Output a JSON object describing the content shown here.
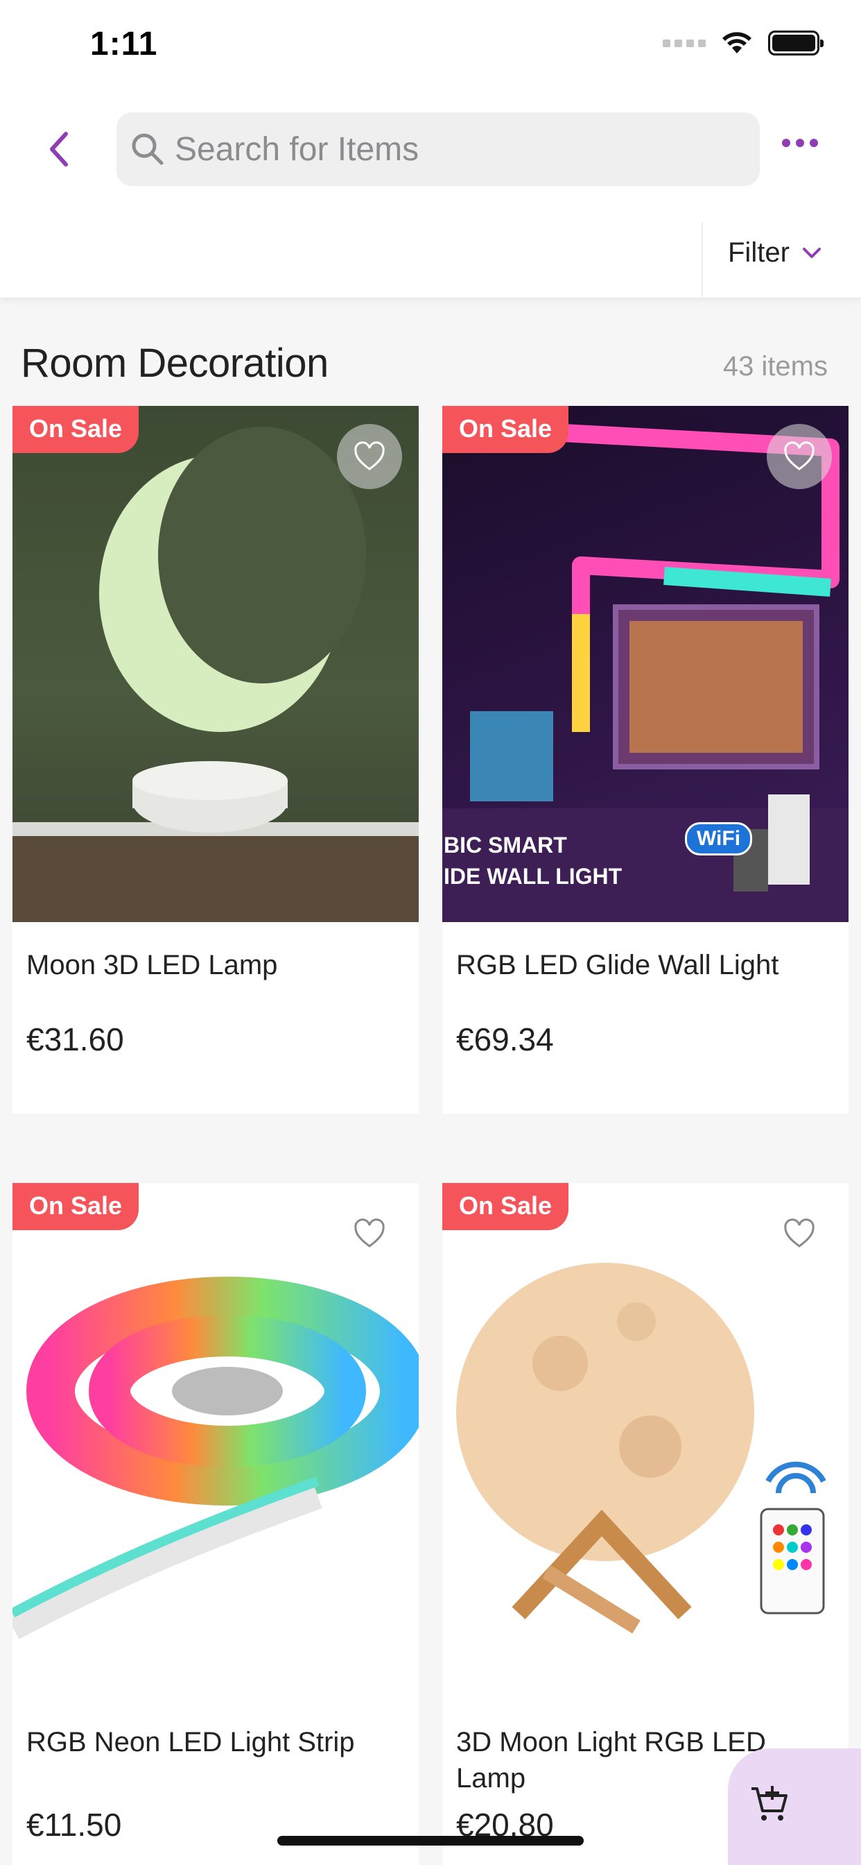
{
  "status_bar": {
    "time": "1:11"
  },
  "header": {
    "search_placeholder": "Search for Items",
    "back_icon": "chevron-left-icon",
    "more_icon": "more-horizontal-icon",
    "accent_color": "#8e3db5"
  },
  "filter": {
    "label": "Filter"
  },
  "section": {
    "title": "Room Decoration",
    "count": "43 items"
  },
  "products": [
    {
      "name": "Moon 3D LED Lamp",
      "price": "€31.60",
      "badge": "On Sale"
    },
    {
      "name": "RGB LED Glide Wall Light",
      "price": "€69.34",
      "badge": "On Sale",
      "image_text_1": "BIC SMART",
      "image_text_2": "IDE WALL LIGHT",
      "image_badge": "WiFi"
    },
    {
      "name": "RGB Neon LED Light Strip",
      "price": "€11.50",
      "badge": "On Sale"
    },
    {
      "name": "3D Moon Light RGB LED Lamp",
      "price": "€20.80",
      "badge": "On Sale"
    }
  ],
  "colors": {
    "sale_badge": "#f4545a",
    "cart_fab_bg": "#ead8f4"
  }
}
